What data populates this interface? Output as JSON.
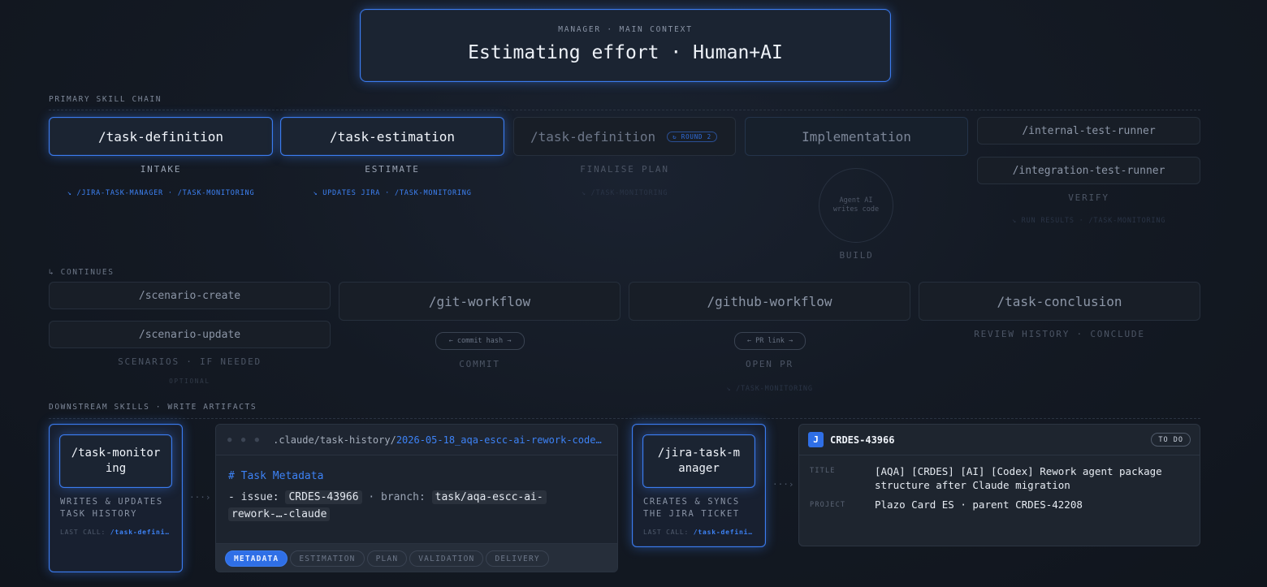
{
  "header": {
    "eyebrow": "MANAGER · MAIN CONTEXT",
    "title": "Estimating effort · Human+AI"
  },
  "primary": {
    "section_label": "PRIMARY SKILL CHAIN",
    "cards": [
      {
        "label": "/task-definition",
        "sub": "INTAKE",
        "link": "↘ /JIRA-TASK-MANAGER · /TASK-MONITORING"
      },
      {
        "label": "/task-estimation",
        "sub": "ESTIMATE",
        "link": "↘ UPDATES JIRA · /TASK-MONITORING"
      },
      {
        "label": "/task-definition",
        "badge": "↻ ROUND 2",
        "sub": "FINALISE PLAN",
        "link": "↘ /TASK-MONITORING"
      },
      {
        "label": "Implementation",
        "circle": "Agent AI writes code",
        "sub": "BUILD"
      },
      {
        "label_a": "/internal-test-runner",
        "label_b": "/integration-test-runner",
        "sub": "VERIFY",
        "link": "↘ RUN RESULTS · /TASK-MONITORING"
      }
    ]
  },
  "continues": {
    "section_label": "↳ CONTINUES",
    "scenario_create": "/scenario-create",
    "scenario_update": "/scenario-update",
    "scenario_sub": "SCENARIOS · IF NEEDED",
    "scenario_note": "OPTIONAL",
    "git": {
      "label": "/git-workflow",
      "pill": "← commit hash →",
      "sub": "COMMIT"
    },
    "github": {
      "label": "/github-workflow",
      "pill": "← PR link →",
      "sub": "OPEN PR",
      "link": "↘ /TASK-MONITORING"
    },
    "conclusion": {
      "label": "/task-conclusion",
      "sub": "REVIEW HISTORY · CONCLUDE"
    }
  },
  "downstream": {
    "section_label": "DOWNSTREAM SKILLS · WRITE ARTIFACTS",
    "monitoring": {
      "label": "/task-monitoring",
      "desc": "WRITES & UPDATES TASK HISTORY",
      "last_call_prefix": "LAST CALL:",
      "last_call_value": "/task-defini…"
    },
    "file": {
      "path_prefix": ".claude/task-history/",
      "path_file": "2026-05-18_aqa-escc-ai-rework-code…",
      "heading": "# Task Metadata",
      "line_issue_label": "- issue:",
      "issue": "CRDES-43966",
      "line_branch_label": "· branch:",
      "branch_a": "task/aqa-escc-ai-",
      "branch_b": "rework-…-claude",
      "tabs": [
        "METADATA",
        "ESTIMATION",
        "PLAN",
        "VALIDATION",
        "DELIVERY"
      ]
    },
    "jira": {
      "label": "/jira-task-manager",
      "desc": "CREATES & SYNCS THE JIRA TICKET",
      "last_call_prefix": "LAST CALL:",
      "last_call_value": "/task-defini…"
    },
    "ticket": {
      "icon_letter": "J",
      "key": "CRDES-43966",
      "status": "TO DO",
      "title_label": "TITLE",
      "title": "[AQA] [CRDES] [AI] [Codex] Rework agent package structure after Claude migration",
      "project_label": "PROJECT",
      "project": "Plazo Card ES · parent CRDES-42208"
    },
    "arrow": "···›"
  },
  "colors": {
    "accent": "#3b7cf0",
    "background": "#141a24"
  }
}
